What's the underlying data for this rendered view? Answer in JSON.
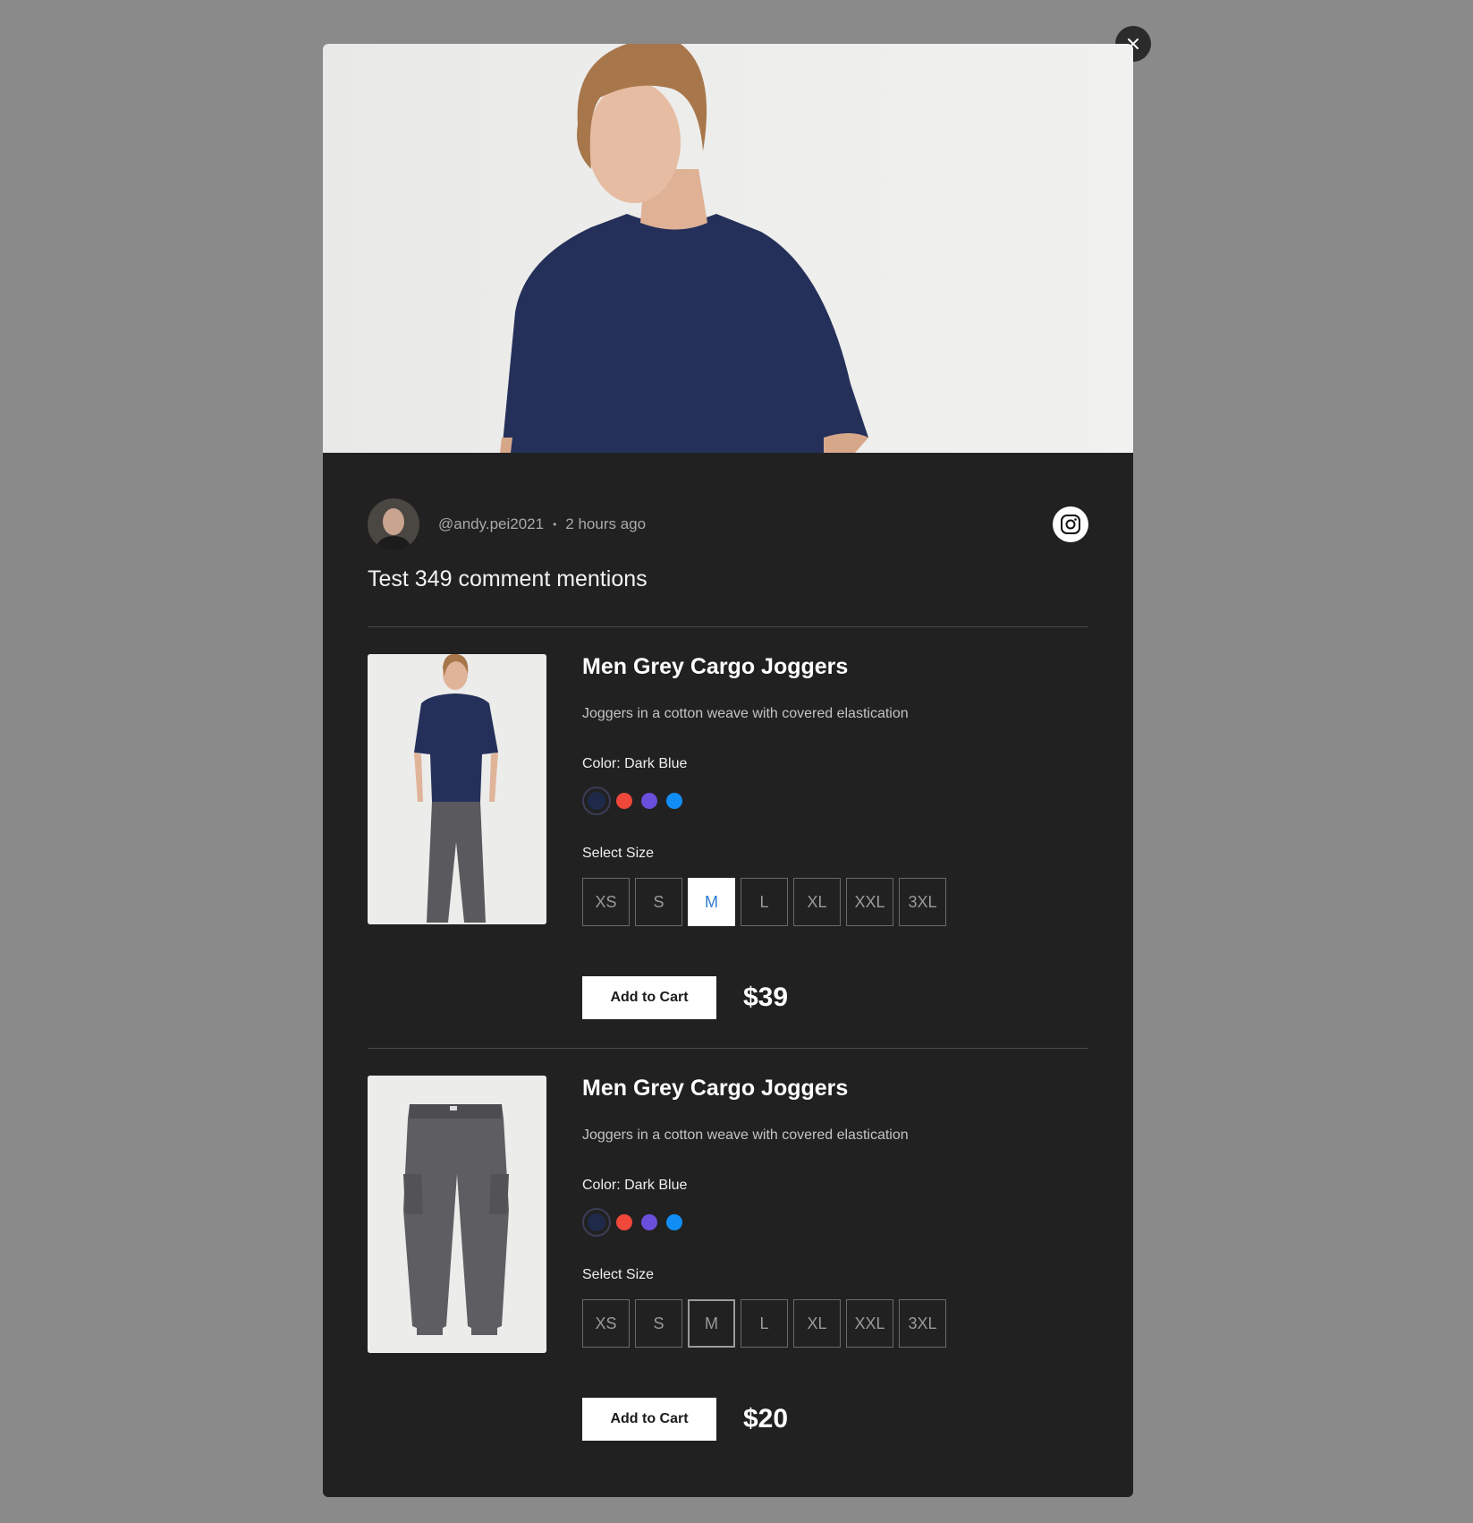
{
  "modal": {
    "close_icon": "close-icon"
  },
  "post": {
    "username": "@andy.pei2021",
    "separator": "•",
    "time_ago": "2 hours ago",
    "text": "Test 349 comment mentions",
    "platform_icon": "instagram-icon"
  },
  "products": [
    {
      "title": "Men Grey Cargo Joggers",
      "description": "Joggers in a cotton weave with covered elastication",
      "color_label": "Color: Dark Blue",
      "colors": [
        "#1f2a4a",
        "#f0473b",
        "#6a4fdc",
        "#118ef5"
      ],
      "selected_color_index": 0,
      "size_label": "Select Size",
      "sizes": [
        "XS",
        "S",
        "M",
        "L",
        "XL",
        "XXL",
        "3XL"
      ],
      "selected_size": "M",
      "add_to_cart": "Add to Cart",
      "price": "$39"
    },
    {
      "title": "Men Grey Cargo Joggers",
      "description": "Joggers in a cotton weave with covered elastication",
      "color_label": "Color: Dark Blue",
      "colors": [
        "#1f2a4a",
        "#f0473b",
        "#6a4fdc",
        "#118ef5"
      ],
      "selected_color_index": 0,
      "size_label": "Select Size",
      "sizes": [
        "XS",
        "S",
        "M",
        "L",
        "XL",
        "XXL",
        "3XL"
      ],
      "selected_size": "M",
      "add_to_cart": "Add to Cart",
      "price": "$20"
    }
  ]
}
